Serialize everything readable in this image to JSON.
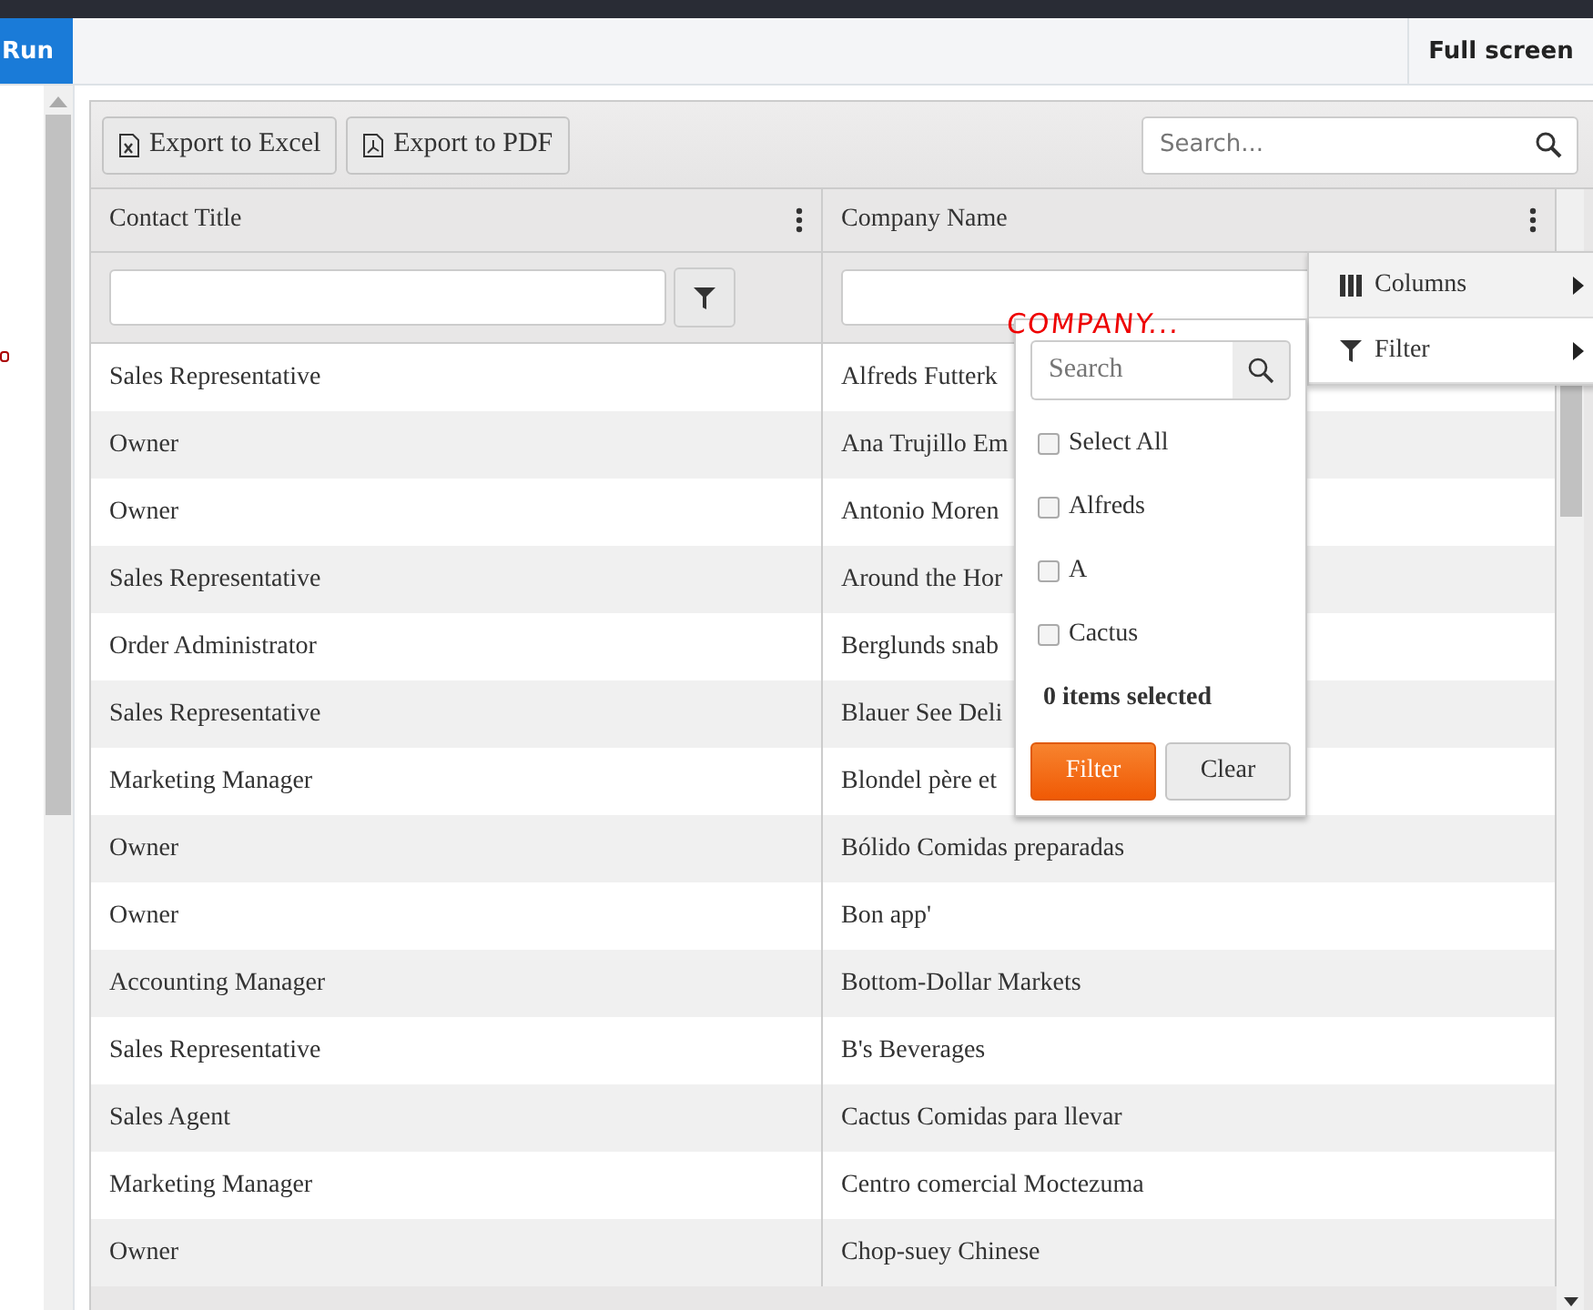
{
  "topbar": {
    "run_button": "Run",
    "fullscreen_button": "Full screen"
  },
  "toolbar": {
    "buttons": [
      {
        "label": "Export to Excel",
        "kind": "excel"
      },
      {
        "label": "Export to PDF",
        "kind": "pdf"
      }
    ],
    "search": {
      "placeholder": "Search..."
    }
  },
  "table": {
    "columns": [
      {
        "label": "Contact Title"
      },
      {
        "label": "Company Name"
      }
    ],
    "rows": [
      [
        "Sales Representative",
        "Alfreds Futterk"
      ],
      [
        "Owner",
        "Ana Trujillo Em"
      ],
      [
        "Owner",
        "Antonio Moren"
      ],
      [
        "Sales Representative",
        "Around the Hor"
      ],
      [
        "Order Administrator",
        "Berglunds snab"
      ],
      [
        "Sales Representative",
        "Blauer See Deli"
      ],
      [
        "Marketing Manager",
        "Blondel père et"
      ],
      [
        "Owner",
        "Bólido Comidas preparadas"
      ],
      [
        "Owner",
        "Bon app'"
      ],
      [
        "Accounting Manager",
        "Bottom-Dollar Markets"
      ],
      [
        "Sales Representative",
        "B's Beverages"
      ],
      [
        "Sales Agent",
        "Cactus Comidas para llevar"
      ],
      [
        "Marketing Manager",
        "Centro comercial Moctezuma"
      ],
      [
        "Owner",
        "Chop-suey Chinese"
      ]
    ]
  },
  "column_menu": {
    "items": [
      {
        "label": "Columns",
        "kind": "columns"
      },
      {
        "label": "Filter",
        "kind": "filter"
      }
    ]
  },
  "filter_popup": {
    "annotation": "COMPANY...",
    "search": {
      "placeholder": "Search"
    },
    "options": [
      {
        "label": "Select All",
        "checked": false
      },
      {
        "label": "Alfreds",
        "checked": false
      },
      {
        "label": "A",
        "checked": false
      },
      {
        "label": "Cactus",
        "checked": false
      }
    ],
    "summary": "0 items selected",
    "filter_button": "Filter",
    "clear_button": "Clear"
  }
}
